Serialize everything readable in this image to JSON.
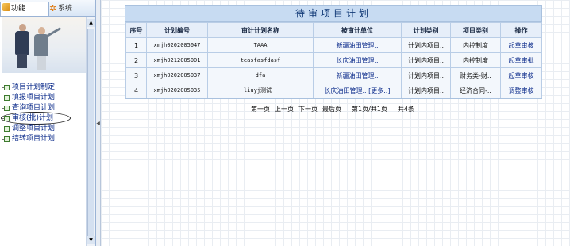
{
  "sidebar": {
    "tabs": [
      {
        "label": "功能",
        "icon": "function-icon"
      },
      {
        "label": "系统",
        "icon": "system-gear-icon"
      }
    ],
    "menu": [
      {
        "label": "项目计划制定"
      },
      {
        "label": "填报项目计划"
      },
      {
        "label": "查询项目计划"
      },
      {
        "label": "审核(批)计划",
        "highlighted": true
      },
      {
        "label": "调整项目计划"
      },
      {
        "label": "结转项目计划"
      }
    ]
  },
  "main": {
    "title": "待审项目计划",
    "columns": [
      "序号",
      "计划编号",
      "审计计划名称",
      "被审计单位",
      "计划类别",
      "项目类别",
      "操作"
    ],
    "rows": [
      {
        "no": "1",
        "code": "xmjh0202005047",
        "name": "TAAA",
        "unit": "新疆油田管理..",
        "plan_type": "计划内项目..",
        "proj_type": "内控制度",
        "action": "起草审核"
      },
      {
        "no": "2",
        "code": "xmjh0212005001",
        "name": "teasfasfdasf",
        "unit": "长庆油田管理..",
        "plan_type": "计划内项目..",
        "proj_type": "内控制度",
        "action": "起草审批"
      },
      {
        "no": "3",
        "code": "xmjh0202005037",
        "name": "dfa",
        "unit": "新疆油田管理..",
        "plan_type": "计划内项目..",
        "proj_type": "财务类-财..",
        "action": "起草审核"
      },
      {
        "no": "4",
        "code": "xmjh0202005035",
        "name": "liuyj测试一",
        "unit": "长庆油田管理..  [更多..]",
        "plan_type": "计划内项目..",
        "proj_type": "经济合同-..",
        "action": "调整审核"
      }
    ],
    "pager": {
      "first": "第一页",
      "prev": "上一页",
      "next": "下一页",
      "last": "最后页",
      "page_info": "第1页/共1页",
      "total": "共4条"
    }
  },
  "colors": {
    "header_bg": "#c7dbf2",
    "link": "#0a2a8a",
    "grid_border": "#b9cde6"
  }
}
